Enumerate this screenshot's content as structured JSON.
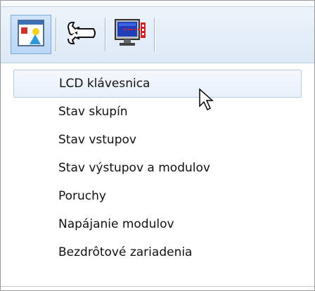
{
  "toolbar": {
    "buttons": [
      {
        "icon": "window-shapes-icon",
        "active": true
      },
      {
        "icon": "wrench-icon",
        "active": false
      },
      {
        "icon": "monitor-keypad-icon",
        "active": false
      }
    ]
  },
  "menu": {
    "items": [
      {
        "label": "LCD klávesnica"
      },
      {
        "label": "Stav skupín"
      },
      {
        "label": "Stav vstupov"
      },
      {
        "label": "Stav výstupov a modulov"
      },
      {
        "label": "Poruchy"
      },
      {
        "label": "Napájanie modulov"
      },
      {
        "label": "Bezdrôtové zariadenia"
      }
    ]
  },
  "colors": {
    "toolbar_bg": "#dde9f6",
    "hover_bg": "#e8f0fb",
    "hover_border": "#b4cde9"
  }
}
